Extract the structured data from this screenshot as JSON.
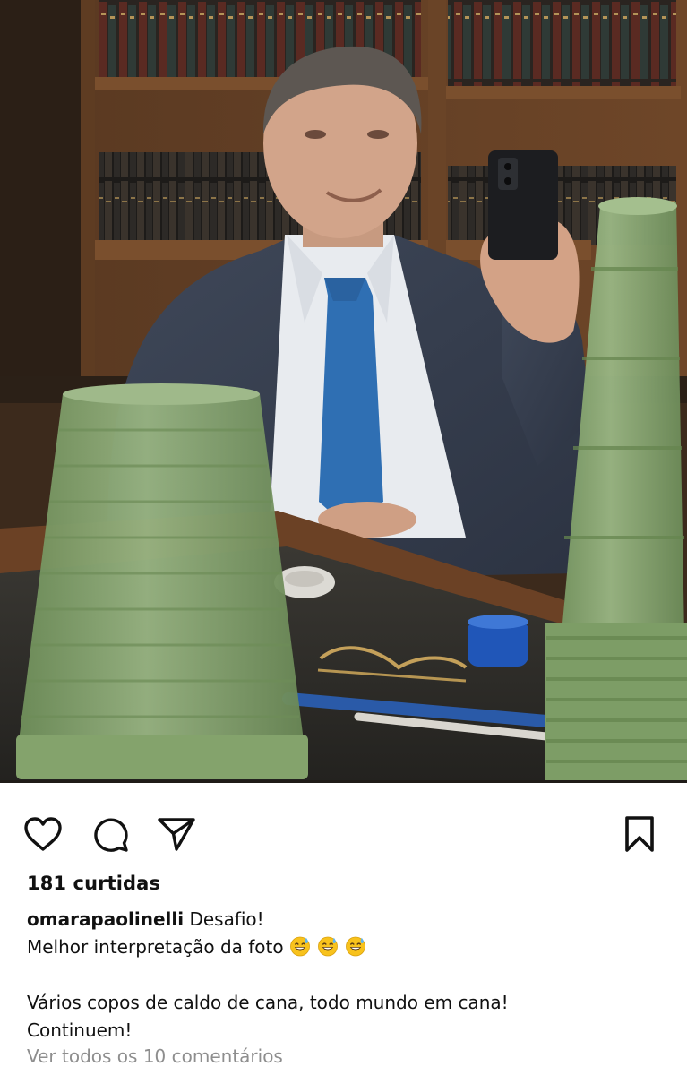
{
  "post": {
    "image": {
      "description_icon": "photo"
    },
    "actions": {
      "like_icon": "heart-icon",
      "comment_icon": "comment-icon",
      "share_icon": "paper-plane-icon",
      "save_icon": "bookmark-icon"
    },
    "likes_text": "181 curtidas",
    "caption": {
      "username": "omarapaolinelli",
      "first_line_text": "Desafio!",
      "second_line_text": "Melhor interpretação da foto",
      "emoji_name": "grinning-face-with-sweat",
      "emoji_count": 3,
      "paragraph_line_1": "Vários copos de caldo de cana, todo mundo em cana!",
      "paragraph_line_2": "Continuem!"
    },
    "view_comments_text": "Ver todos os 10 comentários"
  },
  "colors": {
    "text": "#111111",
    "muted": "#8e8e8e",
    "cup_green": "#7a9a62",
    "tie_blue": "#2f6fb3"
  }
}
